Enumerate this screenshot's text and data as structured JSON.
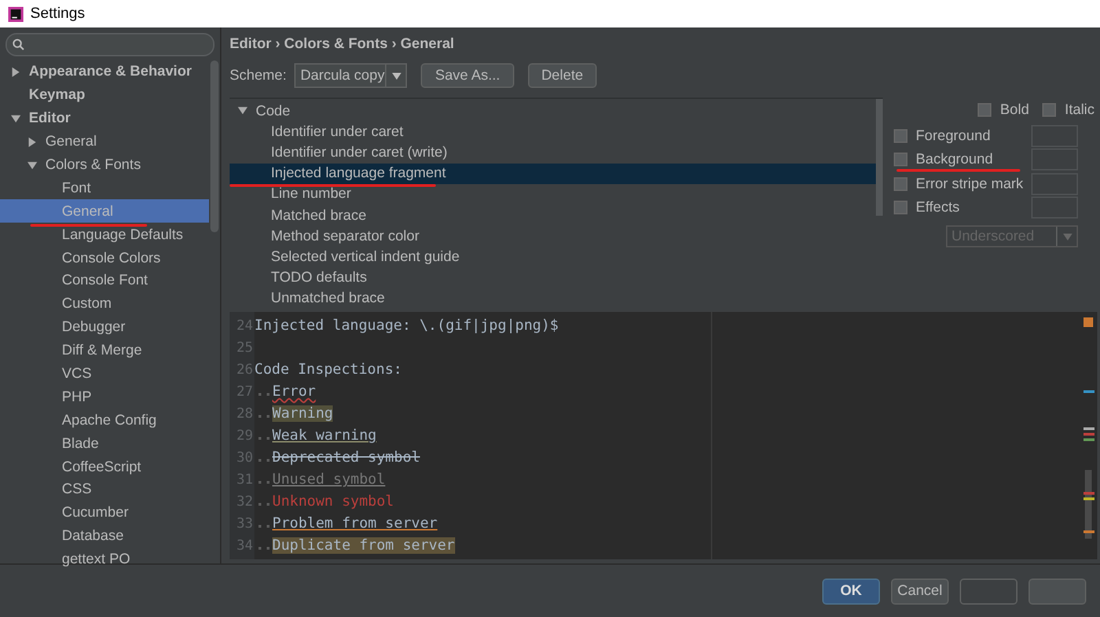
{
  "window": {
    "title": "Settings"
  },
  "sidebar": {
    "items": [
      {
        "label": "Appearance & Behavior",
        "expanded": false,
        "selected": false
      },
      {
        "label": "Keymap",
        "selected": false
      },
      {
        "label": "Editor",
        "expanded": true,
        "selected": false,
        "children": [
          {
            "label": "General",
            "expanded": false,
            "selected": false
          },
          {
            "label": "Colors & Fonts",
            "expanded": true,
            "selected": false,
            "children": [
              {
                "label": "Font",
                "selected": false
              },
              {
                "label": "General",
                "selected": true,
                "marked": true
              },
              {
                "label": "Language Defaults",
                "selected": false
              },
              {
                "label": "Console Colors",
                "selected": false
              },
              {
                "label": "Console Font",
                "selected": false
              },
              {
                "label": "Custom",
                "selected": false
              },
              {
                "label": "Debugger",
                "selected": false
              },
              {
                "label": "Diff & Merge",
                "selected": false
              },
              {
                "label": "VCS",
                "selected": false
              },
              {
                "label": "PHP",
                "selected": false
              },
              {
                "label": "Apache Config",
                "selected": false
              },
              {
                "label": "Blade",
                "selected": false
              },
              {
                "label": "CoffeeScript",
                "selected": false
              },
              {
                "label": "CSS",
                "selected": false
              },
              {
                "label": "Cucumber",
                "selected": false
              },
              {
                "label": "Database",
                "selected": false
              },
              {
                "label": "gettext PO",
                "selected": false
              }
            ]
          }
        ]
      }
    ]
  },
  "breadcrumb": "Editor › Colors & Fonts › General",
  "scheme": {
    "label": "Scheme:",
    "value": "Darcula copy",
    "buttons": [
      "Save As...",
      "Delete"
    ]
  },
  "attributes": [
    {
      "label": "Code",
      "expanded": true,
      "children": [
        {
          "label": "Identifier under caret",
          "selected": false
        },
        {
          "label": "Identifier under caret (write)",
          "selected": false
        },
        {
          "label": "Injected language fragment",
          "selected": true,
          "marked": true
        },
        {
          "label": "Line number",
          "selected": false
        },
        {
          "label": "Matched brace",
          "selected": false
        },
        {
          "label": "Method separator color",
          "selected": false
        },
        {
          "label": "Selected vertical indent guide",
          "selected": false
        },
        {
          "label": "TODO defaults",
          "selected": false
        },
        {
          "label": "Unmatched brace",
          "selected": false
        }
      ]
    }
  ],
  "options": {
    "styles": [
      {
        "label": "Bold",
        "checked": false
      },
      {
        "label": "Italic",
        "checked": false
      }
    ],
    "colors": [
      {
        "label": "Foreground",
        "checked": false
      },
      {
        "label": "Background",
        "checked": false,
        "marked": true
      },
      {
        "label": "Error stripe mark",
        "checked": false
      },
      {
        "label": "Effects",
        "checked": false
      }
    ],
    "effect": {
      "value": "Underscored",
      "disabled": true
    }
  },
  "preview": [
    {
      "number": "24",
      "text": "Injected language: \\.(gif|jpg|png)$",
      "kind": "plain",
      "indented": false
    },
    {
      "number": "25"
    },
    {
      "number": "26",
      "text": "Code Inspections:",
      "kind": "plain",
      "indented": false
    },
    {
      "number": "27",
      "text": "Error",
      "kind": "error",
      "indented": true
    },
    {
      "number": "28",
      "text": "Warning",
      "kind": "warning",
      "indented": true
    },
    {
      "number": "29",
      "text": "Weak warning",
      "kind": "weak",
      "indented": true
    },
    {
      "number": "30",
      "text": "Deprecated symbol",
      "kind": "deprecated",
      "indented": true
    },
    {
      "number": "31",
      "text": "Unused symbol",
      "kind": "unused",
      "indented": true
    },
    {
      "number": "32",
      "text": "Unknown symbol",
      "kind": "unknown",
      "indented": true
    },
    {
      "number": "33",
      "text": "Problem from server",
      "kind": "problem",
      "indented": true
    },
    {
      "number": "34",
      "text": "Duplicate from server",
      "kind": "duplicate",
      "indented": true
    }
  ],
  "buttons": [
    {
      "label": "OK",
      "default": true
    },
    {
      "label": "Cancel",
      "default": false
    }
  ]
}
